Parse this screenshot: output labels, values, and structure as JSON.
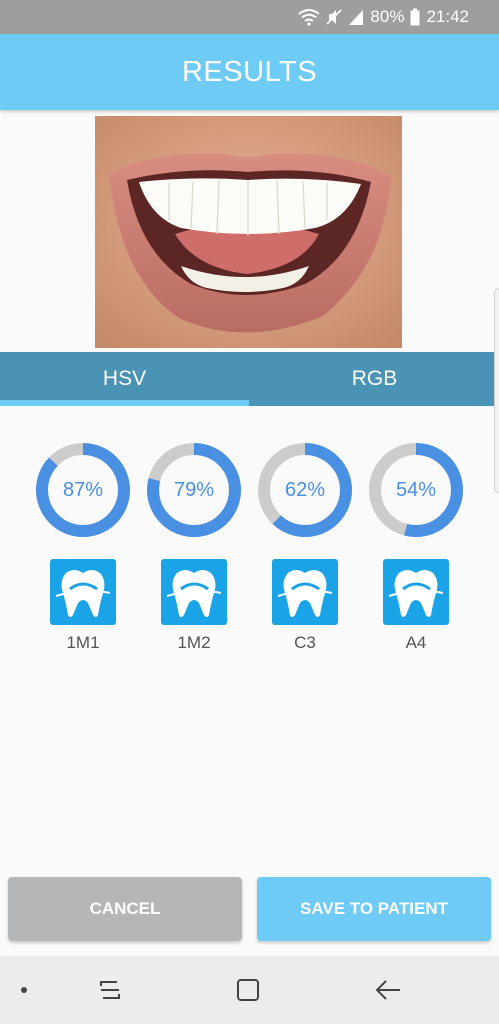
{
  "status_bar": {
    "battery": "80%",
    "time": "21:42",
    "icons": [
      "wifi-icon",
      "mute-icon",
      "signal-icon",
      "battery-icon"
    ]
  },
  "header": {
    "title": "RESULTS"
  },
  "photo": {
    "subject": "smiling-mouth-photo"
  },
  "tabs": [
    {
      "label": "HSV",
      "selected": true
    },
    {
      "label": "RGB",
      "selected": false
    }
  ],
  "results": [
    {
      "percent": 87,
      "percent_label": "87%",
      "shade": "1M1"
    },
    {
      "percent": 79,
      "percent_label": "79%",
      "shade": "1M2"
    },
    {
      "percent": 62,
      "percent_label": "62%",
      "shade": "C3"
    },
    {
      "percent": 54,
      "percent_label": "54%",
      "shade": "A4"
    }
  ],
  "buttons": {
    "cancel": "CANCEL",
    "save": "SAVE TO PATIENT"
  },
  "nav_bar": {
    "icons": [
      "dot-icon",
      "recents-icon",
      "home-icon",
      "back-icon"
    ]
  },
  "colors": {
    "accent": "#6ecbf5",
    "tab_bar": "#4b93b4",
    "gauge_fill": "#4a90e2",
    "gauge_track": "#cccccc",
    "tooth_tile": "#1aa3e6",
    "cancel_button": "#b4b6b8"
  }
}
